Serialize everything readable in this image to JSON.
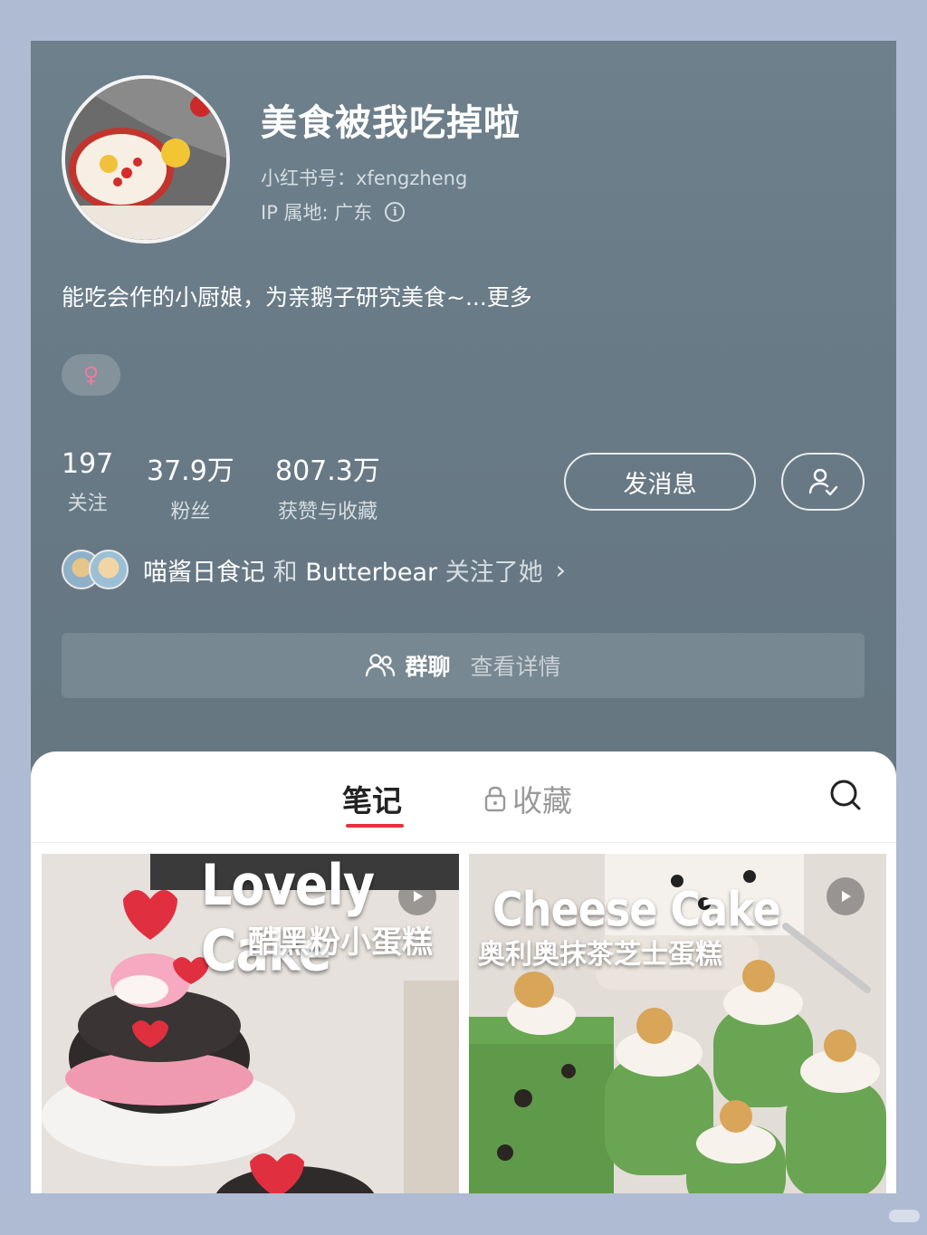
{
  "profile": {
    "nickname": "美食被我吃掉啦",
    "red_id": "小红书号：xfengzheng",
    "ip_location": "IP 属地: 广东",
    "bio": "能吃会作的小厨娘，为亲鹅子研究美食~...更多",
    "gender_symbol": "♀"
  },
  "stats": [
    {
      "value": "197",
      "label": "关注"
    },
    {
      "value": "37.9万",
      "label": "粉丝"
    },
    {
      "value": "807.3万",
      "label": "获赞与收藏"
    }
  ],
  "actions": {
    "message_label": "发消息"
  },
  "mutual": {
    "name1": "喵酱日食记",
    "joiner": "和",
    "name2": "Butterbear",
    "suffix": "关注了她"
  },
  "group": {
    "label": "群聊",
    "detail": "查看详情"
  },
  "tabs": {
    "notes": "笔记",
    "favorites": "收藏"
  },
  "posts": [
    {
      "title": "Lovely Cake",
      "subtitle": "酷黑粉小蛋糕",
      "is_video": true
    },
    {
      "title": "Cheese Cake",
      "subtitle": "奥利奥抹茶芝士蛋糕",
      "is_video": true
    }
  ],
  "colors": {
    "accent": "#e8303e",
    "header_bg": "#687a86",
    "page_bg": "#aebbd3"
  },
  "icons": {
    "info": "info-icon",
    "follow": "user-check-icon",
    "group": "group-icon",
    "lock": "lock-icon",
    "search": "search-icon",
    "play": "play-icon"
  }
}
